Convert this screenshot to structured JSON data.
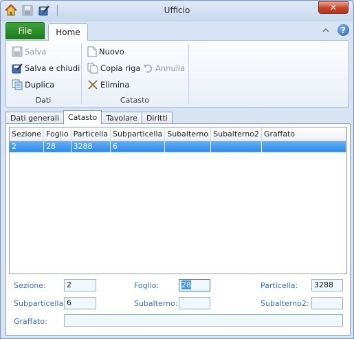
{
  "window": {
    "title": "Ufficio",
    "close_label": "✕"
  },
  "ribbon": {
    "file_tab": "File",
    "home_tab": "Home",
    "groups": {
      "dati": {
        "label": "Dati",
        "salva": "Salva",
        "salva_chiudi": "Salva e chiudi",
        "duplica": "Duplica"
      },
      "catasto": {
        "label": "Catasto",
        "nuovo": "Nuovo",
        "copia_riga": "Copia riga",
        "annulla": "Annulla",
        "elimina": "Elimina"
      }
    }
  },
  "tabs": [
    "Dati generali",
    "Catasto",
    "Tavolare",
    "Diritti"
  ],
  "grid": {
    "columns": [
      "Sezione",
      "Foglio",
      "Particella",
      "Subparticella",
      "Subalterno",
      "Subalterno2",
      "Graffato"
    ],
    "rows": [
      [
        "2",
        "28",
        "3288",
        "6",
        "",
        "",
        ""
      ]
    ]
  },
  "form": {
    "sezione_label": "Sezione:",
    "sezione_value": "2",
    "foglio_label": "Foglio:",
    "foglio_value": "28",
    "particella_label": "Particella:",
    "particella_value": "3288",
    "subparticella_label": "Subparticella:",
    "subparticella_value": "6",
    "subalterno_label": "Subalterno:",
    "subalterno_value": "",
    "subalterno2_label": "Subalterno2:",
    "subalterno2_value": "",
    "graffato_label": "Graffato:",
    "graffato_value": ""
  }
}
